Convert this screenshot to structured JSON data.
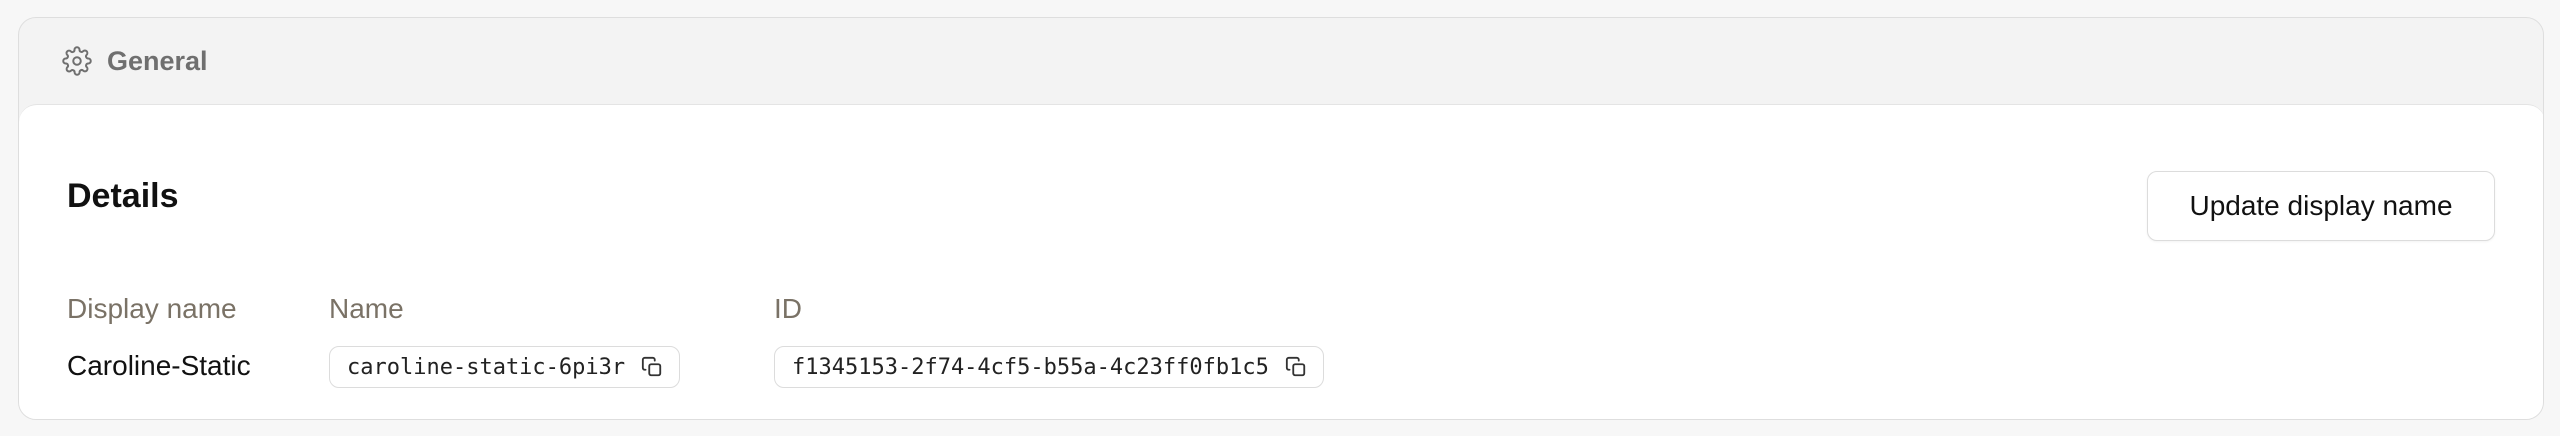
{
  "section": {
    "icon": "gear-icon",
    "title": "General"
  },
  "details": {
    "title": "Details",
    "update_button_label": "Update display name",
    "fields": {
      "display_name": {
        "label": "Display name",
        "value": "Caroline-Static"
      },
      "name": {
        "label": "Name",
        "value": "caroline-static-6pi3r",
        "icon": "copy-icon"
      },
      "id": {
        "label": "ID",
        "value": "f1345153-2f74-4cf5-b55a-4c23ff0fb1c5",
        "icon": "copy-icon"
      }
    }
  }
}
